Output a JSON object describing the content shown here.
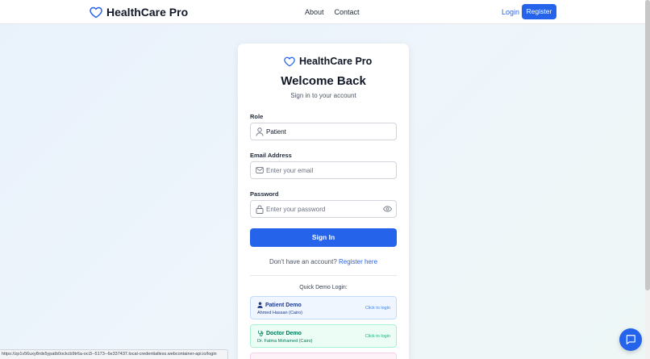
{
  "header": {
    "brand": "HealthCare Pro",
    "nav": [
      "About",
      "Contact"
    ],
    "login": "Login",
    "register": "Register"
  },
  "card": {
    "brand": "HealthCare Pro",
    "title": "Welcome Back",
    "subtitle": "Sign in to your account",
    "role": {
      "label": "Role",
      "value": "Patient"
    },
    "email": {
      "label": "Email Address",
      "placeholder": "Enter your email"
    },
    "password": {
      "label": "Password",
      "placeholder": "Enter your password"
    },
    "signin": "Sign In",
    "no_account": "Don't have an account?",
    "register_link": "Register here",
    "quick_title": "Quick Demo Login:",
    "demos": [
      {
        "title": "Patient Demo",
        "sub": "Ahmed Hassan (Cairo)",
        "cta": "Click to login"
      },
      {
        "title": "Doctor Demo",
        "sub": "Dr. Fatma Mohamed (Cairo)",
        "cta": "Click to login"
      }
    ]
  },
  "status_url": "https://zp1v56uxy8rdx5ypatb0ockcb9tr6a-oci3--5173--6e337437.local-credentialless.webcontainer-api.io/login",
  "colors": {
    "primary": "#2563eb",
    "patient_bg": "#eff6ff",
    "doctor_bg": "#ecfdf5"
  },
  "icons": [
    "heart-icon",
    "user-icon",
    "mail-icon",
    "lock-icon",
    "eye-icon",
    "stethoscope-icon",
    "chat-icon"
  ]
}
